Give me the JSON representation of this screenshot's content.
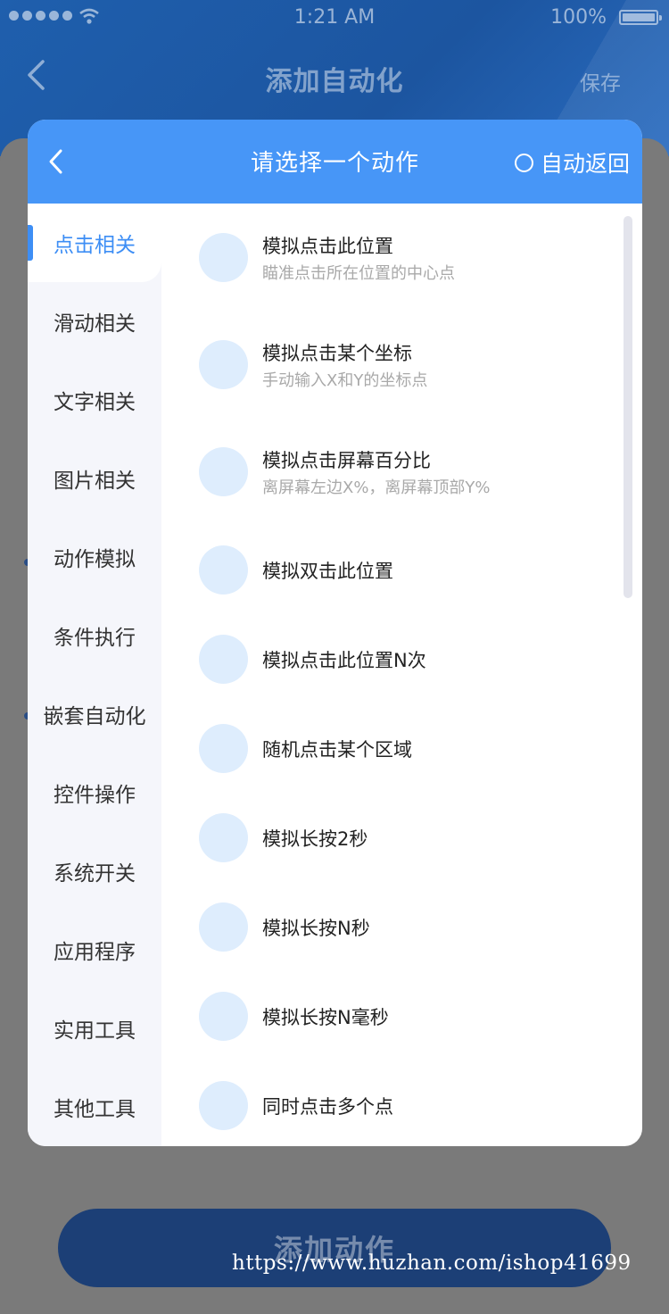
{
  "status_bar": {
    "time": "1:21 AM",
    "battery": "100%"
  },
  "nav": {
    "title": "添加自动化",
    "save": "保存"
  },
  "modal": {
    "title": "请选择一个动作",
    "auto_return": "自动返回",
    "categories": [
      {
        "label": "点击相关",
        "active": true
      },
      {
        "label": "滑动相关"
      },
      {
        "label": "文字相关"
      },
      {
        "label": "图片相关"
      },
      {
        "label": "动作模拟"
      },
      {
        "label": "条件执行"
      },
      {
        "label": "嵌套自动化"
      },
      {
        "label": "控件操作"
      },
      {
        "label": "系统开关"
      },
      {
        "label": "应用程序"
      },
      {
        "label": "实用工具"
      },
      {
        "label": "其他工具"
      }
    ],
    "actions": [
      {
        "title": "模拟点击此位置",
        "subtitle": "瞄准点击所在位置的中心点"
      },
      {
        "title": "模拟点击某个坐标",
        "subtitle": "手动输入X和Y的坐标点"
      },
      {
        "title": "模拟点击屏幕百分比",
        "subtitle": "离屏幕左边X%，离屏幕顶部Y%"
      },
      {
        "title": "模拟双击此位置"
      },
      {
        "title": "模拟点击此位置N次"
      },
      {
        "title": "随机点击某个区域"
      },
      {
        "title": "模拟长按2秒"
      },
      {
        "title": "模拟长按N秒"
      },
      {
        "title": "模拟长按N毫秒"
      },
      {
        "title": "同时点击多个点"
      }
    ]
  },
  "footer": {
    "add_action": "添加动作",
    "watermark": "https://www.huzhan.com/ishop41699"
  },
  "colors": {
    "accent": "#4796f7",
    "active_text": "#3d8ef5",
    "icon_bg": "#deedfd"
  }
}
